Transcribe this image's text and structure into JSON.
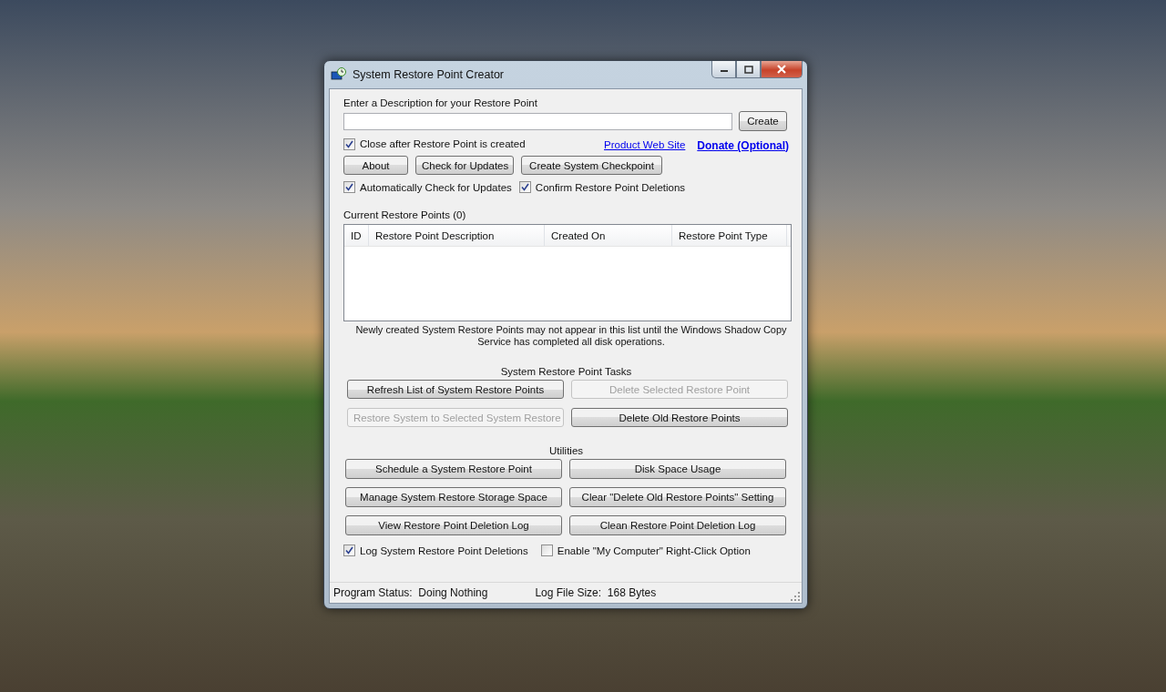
{
  "window": {
    "title": "System Restore Point Creator"
  },
  "description": {
    "label": "Enter a Description for your Restore Point",
    "button": "Create"
  },
  "close_option": {
    "label": "Close after Restore Point is created",
    "checked": true
  },
  "links": [
    {
      "label": "Product Web Site",
      "kind": "plain"
    },
    {
      "label": "Donate (Optional)",
      "kind": "bold"
    }
  ],
  "top_buttons": [
    {
      "label": "About"
    },
    {
      "label": "Check for Updates"
    },
    {
      "label": "Create System Checkpoint"
    }
  ],
  "top_options": [
    {
      "label": "Automatically Check for Updates",
      "checked": true
    },
    {
      "label": "Confirm Restore Point Deletions",
      "checked": true
    }
  ],
  "restore_points": {
    "title": "Current Restore Points (0)",
    "columns": [
      "ID",
      "Restore Point Description",
      "Created On",
      "Restore Point Type"
    ],
    "note": "Newly created System Restore Points may not appear in this list until the Windows Shadow Copy Service has completed all disk operations."
  },
  "tasks": {
    "title": "System Restore Point Tasks",
    "buttons": [
      {
        "label": "Refresh List of System Restore Points",
        "disabled": false
      },
      {
        "label": "Delete Selected Restore Point",
        "disabled": true
      },
      {
        "label": "Restore System to Selected System Restore",
        "disabled": true
      },
      {
        "label": "Delete Old Restore Points",
        "disabled": false
      }
    ]
  },
  "utilities": {
    "title": "Utilities",
    "buttons": [
      {
        "label": "Schedule a System Restore Point",
        "disabled": false
      },
      {
        "label": "Disk Space Usage",
        "disabled": false
      },
      {
        "label": "Manage System Restore Storage Space",
        "disabled": false
      },
      {
        "label": "Clear \"Delete Old Restore Points\" Setting",
        "disabled": false
      },
      {
        "label": "View Restore Point Deletion Log",
        "disabled": false
      },
      {
        "label": "Clean Restore Point Deletion Log",
        "disabled": false
      }
    ]
  },
  "bottom_options": [
    {
      "label": "Log System Restore Point Deletions",
      "checked": true
    },
    {
      "label": "Enable \"My Computer\" Right-Click Option",
      "checked": false
    }
  ],
  "status_bar": {
    "program_status": "Program Status:  Doing Nothing",
    "log_file_size": "Log File Size:  168 Bytes"
  }
}
